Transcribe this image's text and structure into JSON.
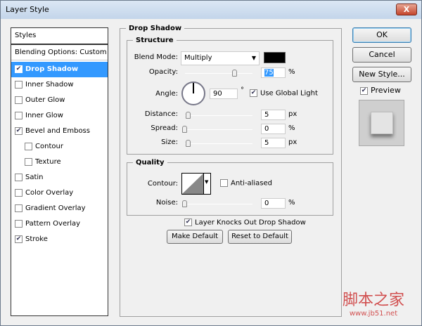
{
  "window": {
    "title": "Layer Style",
    "close": "X"
  },
  "styles": {
    "header": "Styles",
    "blending": "Blending Options: Custom",
    "items": [
      {
        "label": "Drop Shadow",
        "checked": true,
        "selected": true,
        "indent": false
      },
      {
        "label": "Inner Shadow",
        "checked": false,
        "indent": false
      },
      {
        "label": "Outer Glow",
        "checked": false,
        "indent": false
      },
      {
        "label": "Inner Glow",
        "checked": false,
        "indent": false
      },
      {
        "label": "Bevel and Emboss",
        "checked": true,
        "indent": false
      },
      {
        "label": "Contour",
        "checked": false,
        "indent": true
      },
      {
        "label": "Texture",
        "checked": false,
        "indent": true
      },
      {
        "label": "Satin",
        "checked": false,
        "indent": false
      },
      {
        "label": "Color Overlay",
        "checked": false,
        "indent": false
      },
      {
        "label": "Gradient Overlay",
        "checked": false,
        "indent": false
      },
      {
        "label": "Pattern Overlay",
        "checked": false,
        "indent": false
      },
      {
        "label": "Stroke",
        "checked": true,
        "indent": false
      }
    ]
  },
  "panel": {
    "title": "Drop Shadow",
    "structure": {
      "title": "Structure",
      "blend_label": "Blend Mode:",
      "blend_value": "Multiply",
      "color": "#000000",
      "opacity_label": "Opacity:",
      "opacity": "75",
      "opacity_unit": "%",
      "opacity_pct": 75,
      "angle_label": "Angle:",
      "angle": "90",
      "angle_unit": "°",
      "global_light": "Use Global Light",
      "distance_label": "Distance:",
      "distance": "5",
      "distance_unit": "px",
      "spread_label": "Spread:",
      "spread": "0",
      "spread_unit": "%",
      "size_label": "Size:",
      "size": "5",
      "size_unit": "px"
    },
    "quality": {
      "title": "Quality",
      "contour_label": "Contour:",
      "anti_aliased": "Anti-aliased",
      "noise_label": "Noise:",
      "noise": "0",
      "noise_unit": "%"
    },
    "knockout": "Layer Knocks Out Drop Shadow",
    "make_default": "Make Default",
    "reset_default": "Reset to Default"
  },
  "buttons": {
    "ok": "OK",
    "cancel": "Cancel",
    "new_style": "New Style...",
    "preview": "Preview"
  },
  "watermark": "脚本之家 www.jb51.net"
}
